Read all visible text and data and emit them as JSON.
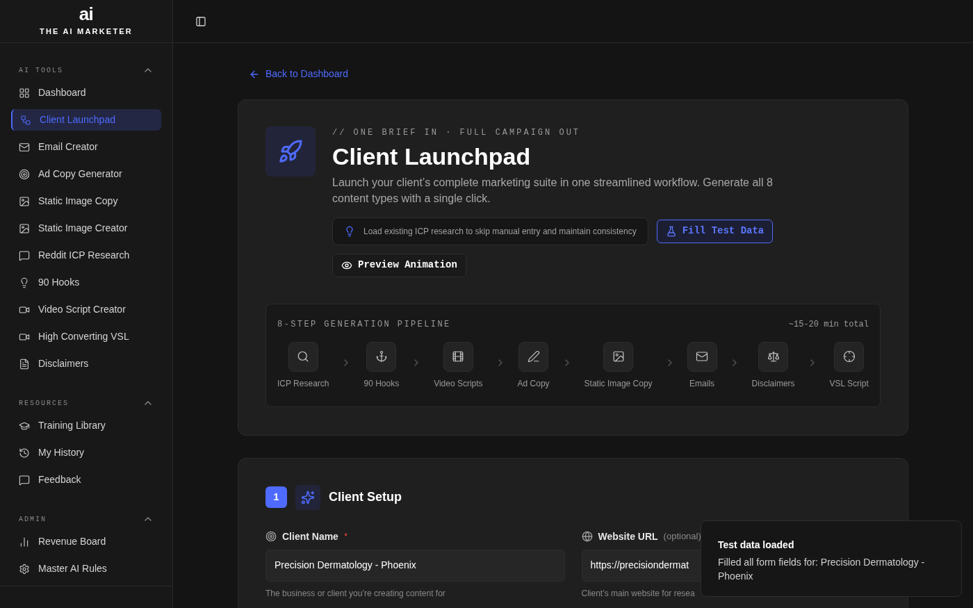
{
  "brand": {
    "logo_mark": "ai",
    "name": "THE AI MARKETER"
  },
  "sidebar": {
    "sections": [
      {
        "title": "AI TOOLS",
        "expanded": true,
        "items": [
          {
            "label": "Dashboard",
            "selected": false
          },
          {
            "label": "Client Launchpad",
            "selected": true
          },
          {
            "label": "Email Creator",
            "selected": false
          },
          {
            "label": "Ad Copy Generator",
            "selected": false
          },
          {
            "label": "Static Image Copy",
            "selected": false
          },
          {
            "label": "Static Image Creator",
            "selected": false
          },
          {
            "label": "Reddit ICP Research",
            "selected": false
          },
          {
            "label": "90 Hooks",
            "selected": false
          },
          {
            "label": "Video Script Creator",
            "selected": false
          },
          {
            "label": "High Converting VSL",
            "selected": false
          },
          {
            "label": "Disclaimers",
            "selected": false
          }
        ]
      },
      {
        "title": "RESOURCES",
        "expanded": true,
        "items": [
          {
            "label": "Training Library",
            "selected": false
          },
          {
            "label": "My History",
            "selected": false
          },
          {
            "label": "Feedback",
            "selected": false
          }
        ]
      },
      {
        "title": "ADMIN",
        "expanded": true,
        "items": [
          {
            "label": "Revenue Board",
            "selected": false
          },
          {
            "label": "Master AI Rules",
            "selected": false
          }
        ]
      }
    ]
  },
  "back_link": "Back to Dashboard",
  "hero": {
    "eyebrow": "// ONE BRIEF IN · FULL CAMPAIGN OUT",
    "title": "Client Launchpad",
    "description": "Launch your client’s complete marketing suite in one streamlined workflow. Generate all 8 content types with a single click.",
    "icp_hint": "Load existing ICP research to skip manual entry and maintain consistency",
    "fill_button": "Fill Test Data",
    "preview_button": "Preview Animation"
  },
  "pipeline": {
    "title": "8-STEP GENERATION PIPELINE",
    "duration": "~15-20 min total",
    "steps": [
      "ICP Research",
      "90 Hooks",
      "Video Scripts",
      "Ad Copy",
      "Static Image Copy",
      "Emails",
      "Disclaimers",
      "VSL Script"
    ]
  },
  "setup": {
    "step": "1",
    "title": "Client Setup",
    "fields": [
      {
        "label": "Client Name",
        "required_mark": "*",
        "value": "Precision Dermatology - Phoenix",
        "hint": "The business or client you’re creating content for"
      },
      {
        "label": "Website URL",
        "optional_note": "(optional)",
        "value": "https://precisiondermat",
        "hint": "Client’s main website for resea"
      }
    ]
  },
  "toast": {
    "title": "Test data loaded",
    "message": "Filled all form fields for: Precision Dermatology - Phoenix"
  }
}
